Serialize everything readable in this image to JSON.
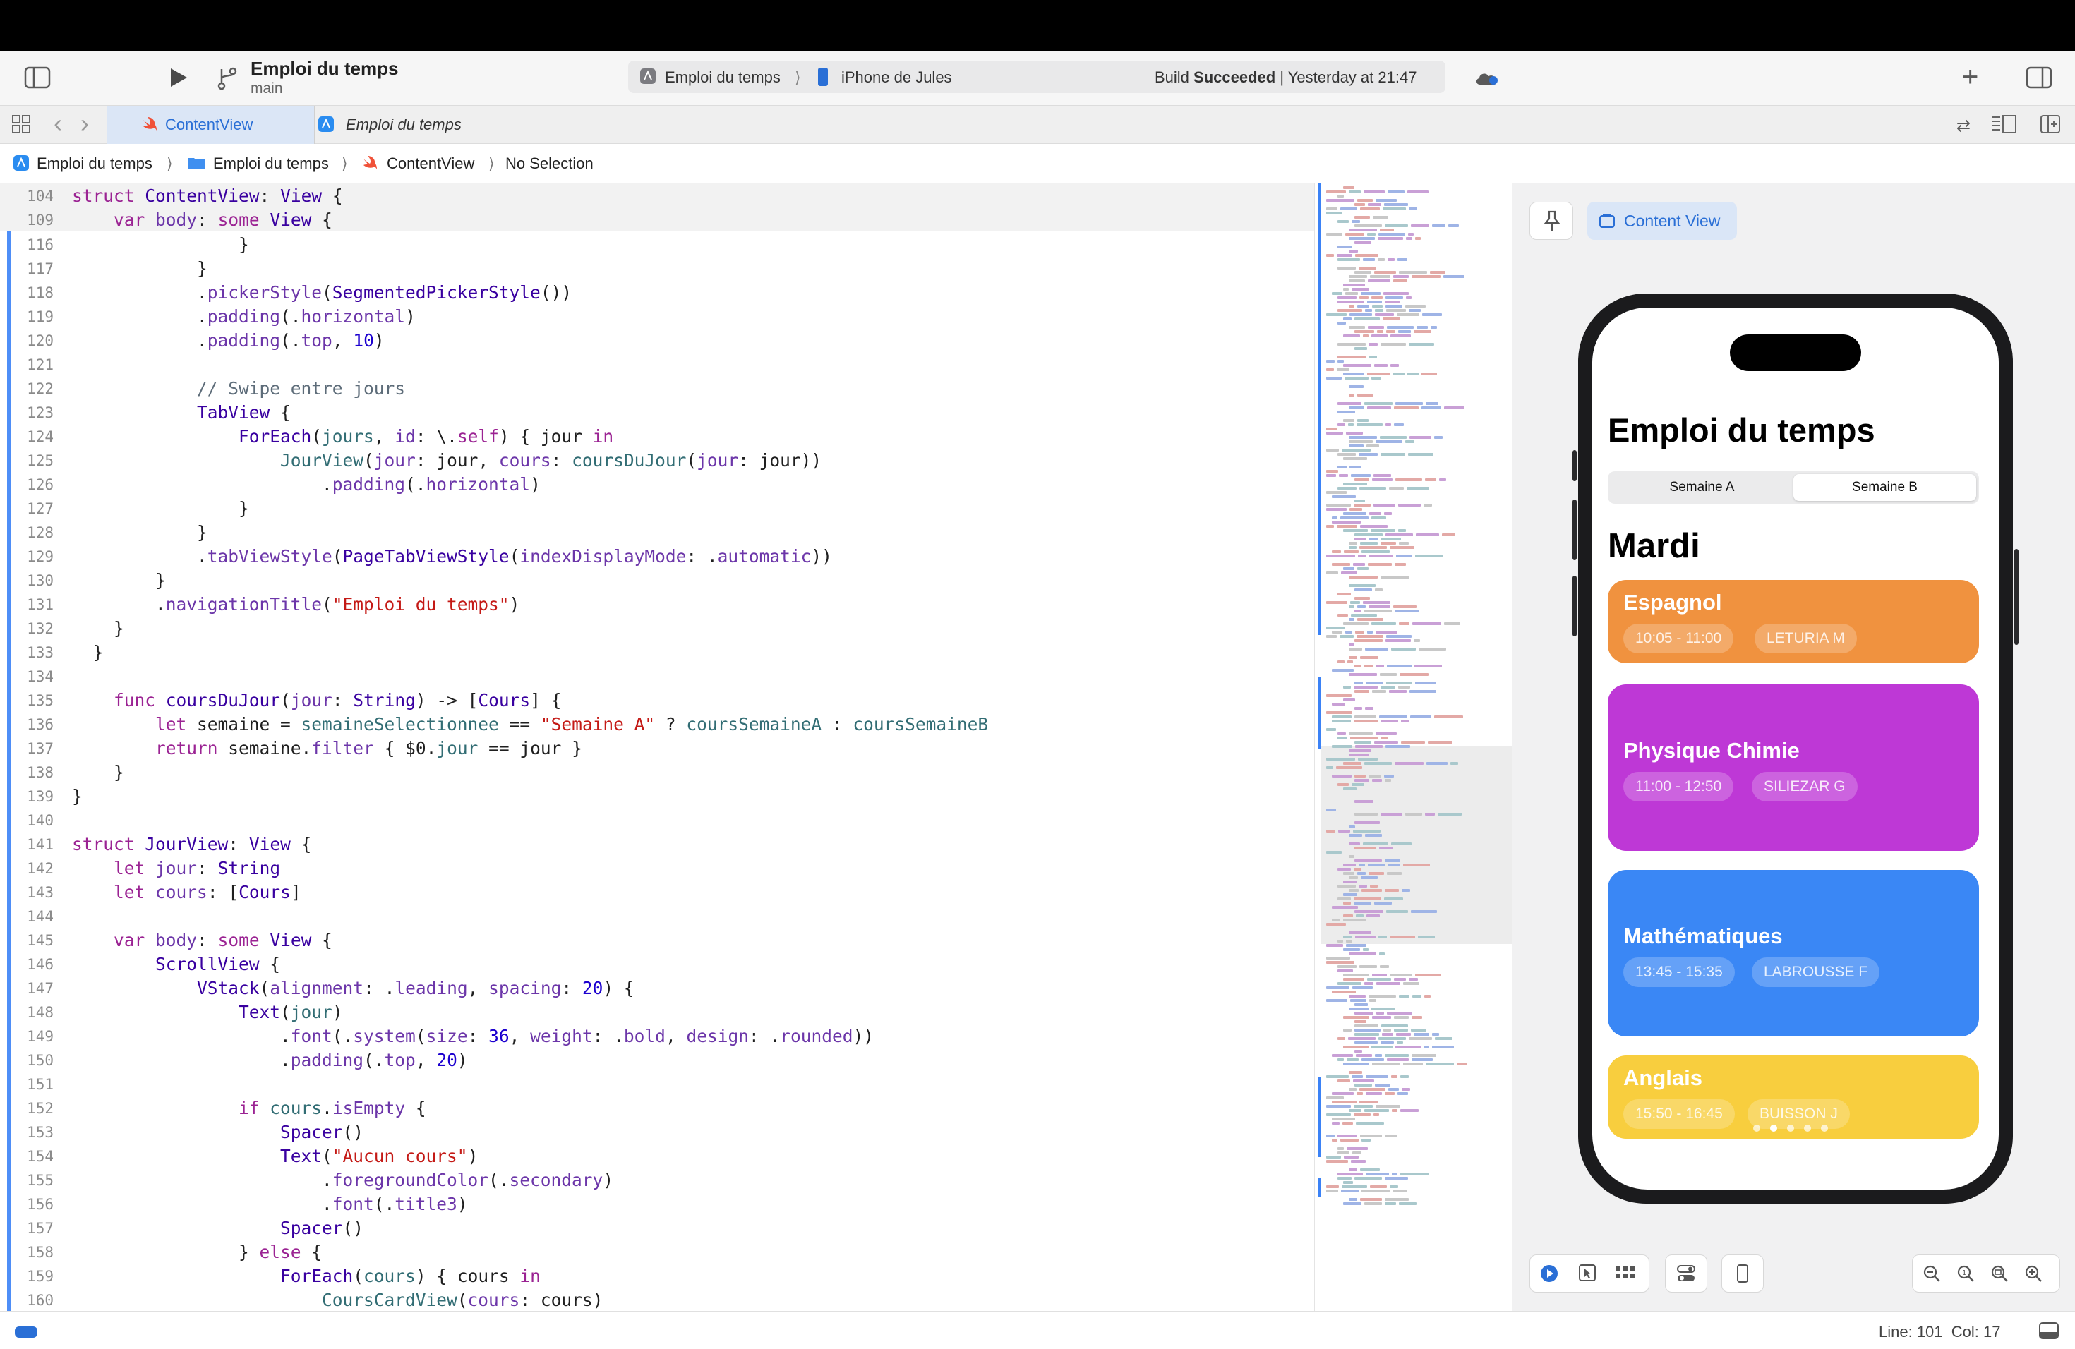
{
  "toolbar": {
    "project_title": "Emploi du temps",
    "branch": "main",
    "scheme": "Emploi du temps",
    "device": "iPhone de Jules",
    "build_status_prefix": "Build",
    "build_status_strong": "Succeeded",
    "build_time": "| Yesterday at 21:47",
    "add_label": "+"
  },
  "tabs": [
    {
      "label": "ContentView",
      "active": true
    },
    {
      "label": "Emploi du temps",
      "active": false
    }
  ],
  "jumpbar": {
    "project": "Emploi du temps",
    "group": "Emploi du temps",
    "file": "ContentView",
    "selection": "No Selection"
  },
  "editor": {
    "sticky": [
      {
        "n": "104",
        "html": "<span class=\"kw\">struct</span> <span class=\"ty\">ContentView</span>: <span class=\"ty\">View</span> {"
      },
      {
        "n": "109",
        "html": "    <span class=\"kw\">var</span> <span class=\"fn\">body</span>: <span class=\"kw\">some</span> <span class=\"ty\">View</span> {"
      }
    ],
    "lines": [
      {
        "n": "116",
        "html": "                }"
      },
      {
        "n": "117",
        "html": "            }"
      },
      {
        "n": "118",
        "html": "            .<span class=\"fn\">pickerStyle</span>(<span class=\"ty\">SegmentedPickerStyle</span>())"
      },
      {
        "n": "119",
        "html": "            .<span class=\"fn\">padding</span>(.<span class=\"fn\">horizontal</span>)"
      },
      {
        "n": "120",
        "html": "            .<span class=\"fn\">padding</span>(.<span class=\"fn\">top</span>, <span class=\"num\">10</span>)"
      },
      {
        "n": "121",
        "html": ""
      },
      {
        "n": "122",
        "html": "            <span class=\"cm\">// Swipe entre jours</span>"
      },
      {
        "n": "123",
        "html": "            <span class=\"ty\">TabView</span> {"
      },
      {
        "n": "124",
        "html": "                <span class=\"ty\">ForEach</span>(<span class=\"pr\">jours</span>, <span class=\"fn\">id</span>: \\.<span class=\"kw\">self</span>) { jour <span class=\"kw\">in</span>"
      },
      {
        "n": "125",
        "html": "                    <span class=\"pr\">JourView</span>(<span class=\"fn\">jour</span>: jour, <span class=\"fn\">cours</span>: <span class=\"pr\">coursDuJour</span>(<span class=\"fn\">jour</span>: jour))"
      },
      {
        "n": "126",
        "html": "                        .<span class=\"fn\">padding</span>(.<span class=\"fn\">horizontal</span>)"
      },
      {
        "n": "127",
        "html": "                }"
      },
      {
        "n": "128",
        "html": "            }"
      },
      {
        "n": "129",
        "html": "            .<span class=\"fn\">tabViewStyle</span>(<span class=\"ty\">PageTabViewStyle</span>(<span class=\"fn\">indexDisplayMode</span>: .<span class=\"fn\">automatic</span>))"
      },
      {
        "n": "130",
        "html": "        }"
      },
      {
        "n": "131",
        "html": "        .<span class=\"fn\">navigationTitle</span>(<span class=\"str\">\"Emploi du temps\"</span>)"
      },
      {
        "n": "132",
        "html": "    }"
      },
      {
        "n": "133",
        "html": "  }"
      },
      {
        "n": "134",
        "html": ""
      },
      {
        "n": "135",
        "html": "    <span class=\"kw\">func</span> <span class=\"ty\">coursDuJour</span>(<span class=\"fn\">jour</span>: <span class=\"ty\">String</span>) -> [<span class=\"ty\">Cours</span>] {"
      },
      {
        "n": "136",
        "html": "        <span class=\"kw\">let</span> semaine = <span class=\"pr\">semaineSelectionnee</span> == <span class=\"str\">\"Semaine A\"</span> ? <span class=\"pr\">coursSemaineA</span> : <span class=\"pr\">coursSemaineB</span>"
      },
      {
        "n": "137",
        "html": "        <span class=\"kw\">return</span> semaine.<span class=\"fn\">filter</span> { $0.<span class=\"pr\">jour</span> == jour }"
      },
      {
        "n": "138",
        "html": "    }"
      },
      {
        "n": "139",
        "html": "}"
      },
      {
        "n": "140",
        "html": ""
      },
      {
        "n": "141",
        "html": "<span class=\"kw\">struct</span> <span class=\"ty\">JourView</span>: <span class=\"ty\">View</span> {"
      },
      {
        "n": "142",
        "html": "    <span class=\"kw\">let</span> <span class=\"fn\">jour</span>: <span class=\"ty\">String</span>"
      },
      {
        "n": "143",
        "html": "    <span class=\"kw\">let</span> <span class=\"fn\">cours</span>: [<span class=\"ty\">Cours</span>]"
      },
      {
        "n": "144",
        "html": ""
      },
      {
        "n": "145",
        "html": "    <span class=\"kw\">var</span> <span class=\"fn\">body</span>: <span class=\"kw\">some</span> <span class=\"ty\">View</span> {"
      },
      {
        "n": "146",
        "html": "        <span class=\"ty\">ScrollView</span> {"
      },
      {
        "n": "147",
        "html": "            <span class=\"ty\">VStack</span>(<span class=\"fn\">alignment</span>: .<span class=\"fn\">leading</span>, <span class=\"fn\">spacing</span>: <span class=\"num\">20</span>) {"
      },
      {
        "n": "148",
        "html": "                <span class=\"ty\">Text</span>(<span class=\"pr\">jour</span>)"
      },
      {
        "n": "149",
        "html": "                    .<span class=\"fn\">font</span>(.<span class=\"fn\">system</span>(<span class=\"fn\">size</span>: <span class=\"num\">36</span>, <span class=\"fn\">weight</span>: .<span class=\"fn\">bold</span>, <span class=\"fn\">design</span>: .<span class=\"fn\">rounded</span>))"
      },
      {
        "n": "150",
        "html": "                    .<span class=\"fn\">padding</span>(.<span class=\"fn\">top</span>, <span class=\"num\">20</span>)"
      },
      {
        "n": "151",
        "html": ""
      },
      {
        "n": "152",
        "html": "                <span class=\"kw\">if</span> <span class=\"pr\">cours</span>.<span class=\"fn\">isEmpty</span> {"
      },
      {
        "n": "153",
        "html": "                    <span class=\"ty\">Spacer</span>()"
      },
      {
        "n": "154",
        "html": "                    <span class=\"ty\">Text</span>(<span class=\"str\">\"Aucun cours\"</span>)"
      },
      {
        "n": "155",
        "html": "                        .<span class=\"fn\">foregroundColor</span>(.<span class=\"fn\">secondary</span>)"
      },
      {
        "n": "156",
        "html": "                        .<span class=\"fn\">font</span>(.<span class=\"fn\">title3</span>)"
      },
      {
        "n": "157",
        "html": "                    <span class=\"ty\">Spacer</span>()"
      },
      {
        "n": "158",
        "html": "                } <span class=\"kw\">else</span> {"
      },
      {
        "n": "159",
        "html": "                    <span class=\"ty\">ForEach</span>(<span class=\"pr\">cours</span>) { cours <span class=\"kw\">in</span>"
      },
      {
        "n": "160",
        "html": "                        <span class=\"pr\">CoursCardView</span>(<span class=\"fn\">cours</span>: cours)"
      }
    ]
  },
  "canvas": {
    "content_view_label": "Content View",
    "preview": {
      "title": "Emploi du temps",
      "segments": [
        {
          "label": "Semaine A",
          "selected": false
        },
        {
          "label": "Semaine B",
          "selected": true
        }
      ],
      "day": "Mardi",
      "cards": [
        {
          "subject": "Espagnol",
          "time": "10:05 - 11:00",
          "teacher": "LETURIA M",
          "color": "#F0923F"
        },
        {
          "subject": "Physique Chimie",
          "time": "11:00 - 12:50",
          "teacher": "SILIEZAR G",
          "color": "#BE38D6"
        },
        {
          "subject": "Mathématiques",
          "time": "13:45 - 15:35",
          "teacher": "LABROUSSE F",
          "color": "#3A87F5"
        },
        {
          "subject": "Anglais",
          "time": "15:50 - 16:45",
          "teacher": "BUISSON J",
          "color": "#F8CE3E"
        }
      ]
    }
  },
  "statusbar": {
    "position": "Line: 101  Col: 17"
  },
  "colors": {
    "accent": "#2A6FD6",
    "toolbar_bg": "#F6F6F6"
  }
}
